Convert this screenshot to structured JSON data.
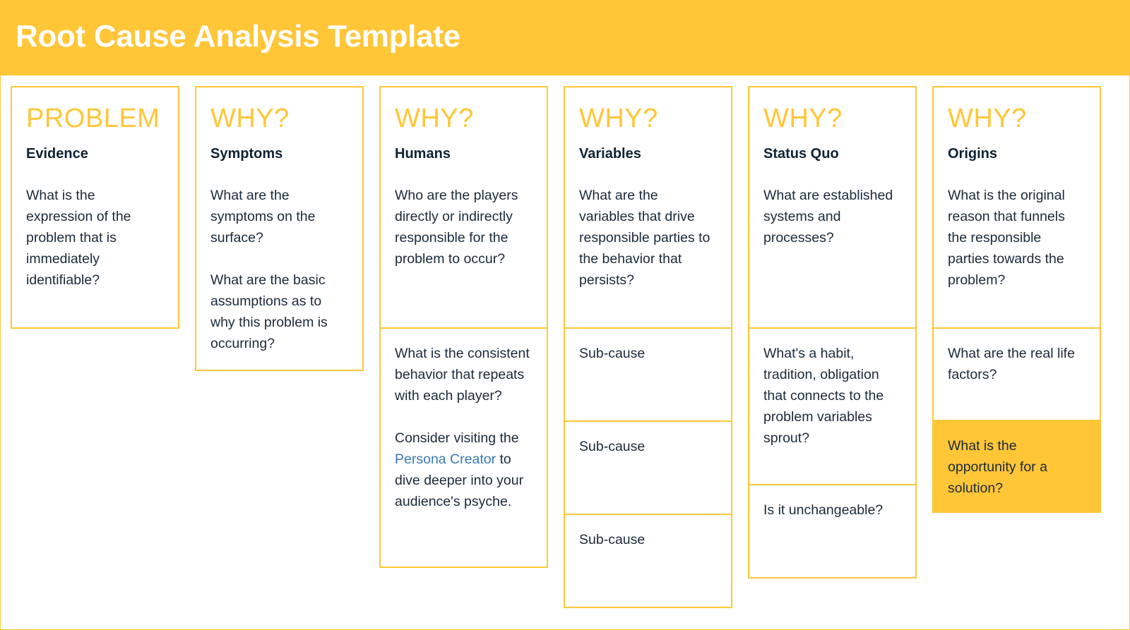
{
  "header": {
    "title": "Root Cause Analysis Template"
  },
  "colors": {
    "accent": "#ffc637",
    "text": "#1b2a3a",
    "link": "#3a79b6"
  },
  "columns": [
    {
      "heading": "PROBLEM",
      "subheading": "Evidence",
      "paragraphs": [
        "What is the expression of the problem that is immediately identifiable?"
      ]
    },
    {
      "heading": "WHY?",
      "subheading": "Symptoms",
      "paragraphs": [
        "What are the symptoms on the surface?",
        "What are the basic assumptions as to why this problem is occurring?"
      ]
    },
    {
      "heading": "WHY?",
      "subheading": "Humans",
      "paragraphs": [
        "Who are the players directly or indirectly responsible for the problem to occur?"
      ],
      "cells": [
        {
          "text": "What is the consistent behavior that repeats with each player?",
          "text2_before": "Consider visiting the",
          "link": "Persona Creator",
          "text2_after": "to dive deeper into your audience's psyche."
        }
      ]
    },
    {
      "heading": "WHY?",
      "subheading": "Variables",
      "paragraphs": [
        "What are the variables that drive responsible parties to the behavior that persists?"
      ],
      "cells": [
        {
          "text": "Sub-cause"
        },
        {
          "text": "Sub-cause"
        },
        {
          "text": "Sub-cause"
        }
      ]
    },
    {
      "heading": "WHY?",
      "subheading": "Status Quo",
      "paragraphs": [
        "What are established systems and processes?"
      ],
      "cells": [
        {
          "text": "What's a habit, tradition, obligation that connects to the problem variables sprout?"
        },
        {
          "text": "Is it unchangeable?"
        }
      ]
    },
    {
      "heading": "WHY?",
      "subheading": "Origins",
      "paragraphs": [
        "What is the original reason that funnels the responsible parties towards the problem?"
      ],
      "cells": [
        {
          "text": "What are the real life factors?"
        },
        {
          "text": "What is the opportunity for a solution?",
          "highlighted": true
        }
      ]
    }
  ]
}
